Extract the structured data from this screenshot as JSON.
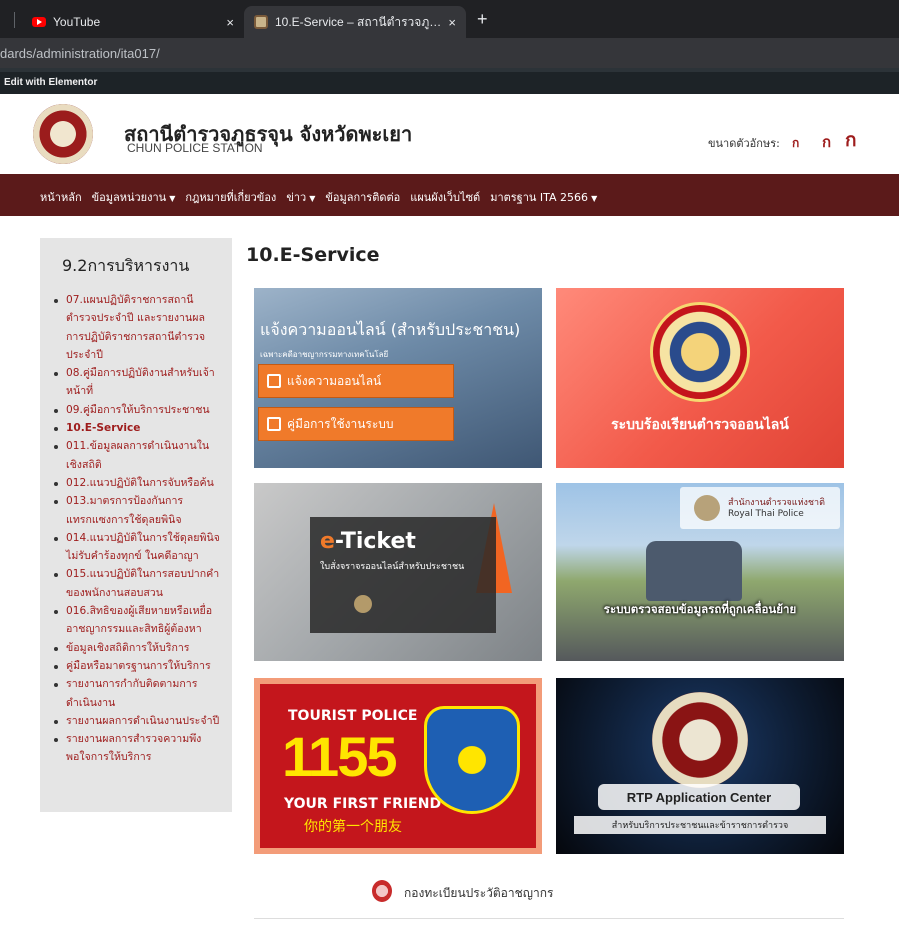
{
  "browser": {
    "tabs": [
      {
        "label": "YouTube",
        "close": "×"
      },
      {
        "label": "10.E-Service – สถานีตำรวจภูธรจุน จังหวัดพะเยา",
        "close": "×"
      }
    ],
    "new_tab": "+",
    "url": "dards/administration/ita017/"
  },
  "wp_admin_bar": {
    "edit_label": "Edit with Elementor"
  },
  "site": {
    "title": "สถานีตำรวจภูธรจุน จังหวัดพะเยา",
    "subtitle": "CHUN POLICE STATION",
    "font_size_label": "ขนาดตัวอักษร:",
    "font_buttons": [
      "ก",
      "ก",
      "ก"
    ]
  },
  "nav": [
    {
      "label": "หน้าหลัก",
      "has_dropdown": false
    },
    {
      "label": "ข้อมูลหน่วยงาน",
      "has_dropdown": true
    },
    {
      "label": "กฎหมายที่เกี่ยวข้อง",
      "has_dropdown": false
    },
    {
      "label": "ข่าว",
      "has_dropdown": true
    },
    {
      "label": "ข้อมูลการติดต่อ",
      "has_dropdown": false
    },
    {
      "label": "แผนผังเว็บไซต์",
      "has_dropdown": false
    },
    {
      "label": "มาตรฐาน ITA 2566",
      "has_dropdown": true
    }
  ],
  "nav_caret": "▼",
  "sidebar": {
    "title": "9.2การบริหารงาน",
    "items": [
      "07.แผนปฏิบัติราชการสถานีตำรวจประจำปี และรายงานผลการปฏิบัติราชการสถานีตำรวจประจำปี",
      "08.คู่มือการปฏิบัติงานสำหรับเจ้าหน้าที่",
      "09.คู่มือการให้บริการประชาชน",
      "10.E-Service",
      "011.ข้อมูลผลการดำเนินงานในเชิงสถิติ",
      "012.แนวปฏิบัติในการจับหรือค้น",
      "013.มาตรการป้องกันการแทรกแซงการใช้ดุลยพินิจ",
      "014.แนวปฏิบัติในการใช้ดุลยพินิจไม่รับคำร้องทุกข์ ในคดีอาญา",
      "015.แนวปฏิบัติในการสอบปากคำของพนักงานสอบสวน",
      "016.สิทธิของผู้เสียหายหรือเหยื่ออาชญากรรมและสิทธิผู้ต้องหา",
      "ข้อมูลเชิงสถิติการให้บริการ",
      "คู่มือหรือมาตรฐานการให้บริการ",
      "รายงานการกำกับติดตามการดำเนินงาน",
      "รายงานผลการดำเนินงานประจำปี",
      "รายงานผลการสำรวจความพึงพอใจการให้บริการ"
    ],
    "active_index": 3
  },
  "main": {
    "title": "10.E-Service",
    "cards": {
      "online_report": {
        "headline": "แจ้งความออนไลน์ (สำหรับประชาชน)",
        "sub": "เฉพาะคดีอาชญากรรมทางเทคโนโลยี",
        "btn1": "แจ้งความออนไลน์",
        "btn2": "คู่มือการใช้งานระบบ"
      },
      "complaint": {
        "caption": "ระบบร้องเรียนตำรวจออนไลน์"
      },
      "eticket": {
        "title_e": "e",
        "title_rest": "-Ticket",
        "sub": "ใบสั่งจราจรออนไลน์สำหรับประชาชน"
      },
      "vehicle": {
        "logo_th": "สำนักงานตำรวจแห่งชาติ",
        "logo_en": "Royal Thai Police",
        "caption": "ระบบตรวจสอบข้อมูลรถที่ถูกเคลื่อนย้าย"
      },
      "tourist": {
        "top": "TOURIST POLICE",
        "number": "1155",
        "friend": "YOUR FIRST FRIEND",
        "chinese": "你的第一个朋友"
      },
      "rtp": {
        "title": "RTP Application Center",
        "sub": "สำหรับบริการประชาชนและข้าราชการตำรวจ"
      }
    },
    "footer_link": "กองทะเบียนประวัติอาชญากร"
  }
}
